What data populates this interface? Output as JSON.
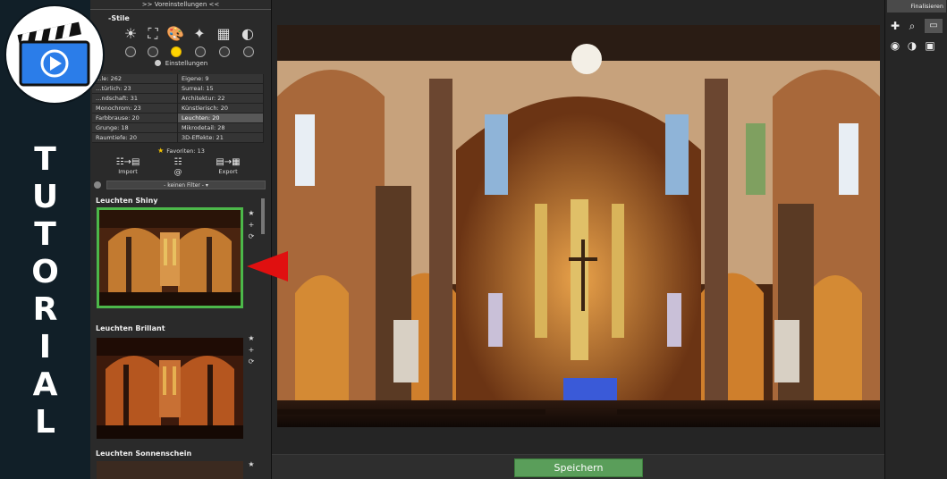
{
  "overlay": {
    "tutorial_letters": [
      "T",
      "U",
      "T",
      "O",
      "R",
      "I",
      "A",
      "L"
    ],
    "logo_icon": "clapperboard-play-icon"
  },
  "panel": {
    "header_title": ">> Voreinstellungen <<",
    "styles_label": "-Stile",
    "settings_label": "Einstellungen",
    "categories": [
      [
        "…le: 262",
        "Eigene: 9"
      ],
      [
        "…türlich: 23",
        "Surreal: 15"
      ],
      [
        "…ndschaft: 31",
        "Architektur: 22"
      ],
      [
        "Monochrom: 23",
        "Künstlerisch: 20"
      ],
      [
        "Farbbrause: 20",
        "Leuchten: 20"
      ],
      [
        "Grunge: 18",
        "Mikrodetail: 28"
      ],
      [
        "Raumtiefe: 20",
        "3D-Effekte: 21"
      ]
    ],
    "favorites_label": "Favoriten: 13",
    "import_label": "Import",
    "at_label": "@",
    "export_label": "Export",
    "filter_value": "- keinen Filter -",
    "presets": [
      {
        "title": "Leuchten Shiny"
      },
      {
        "title": "Leuchten Brillant"
      },
      {
        "title": "Leuchten Sonnenschein"
      }
    ]
  },
  "canvas": {
    "save_label": "Speichern"
  },
  "right_panel": {
    "tab_label": "Finalisieren"
  },
  "colors": {
    "accent_green": "#4cb84a",
    "save_button": "#5a9e5a",
    "arrow_red": "#e01010",
    "favorite_star": "#f5c400"
  }
}
